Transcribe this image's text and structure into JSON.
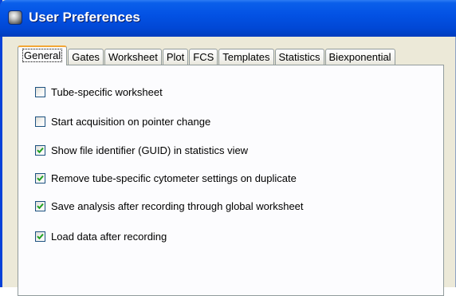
{
  "window": {
    "title": "User Preferences",
    "icon": "app-icon",
    "colors": {
      "titlebar": "#0352e4",
      "frame": "#0842d8",
      "tab_active_accent": "#f3a736",
      "check": "#21a121"
    }
  },
  "tabs": [
    {
      "label": "General",
      "active": true
    },
    {
      "label": "Gates",
      "active": false
    },
    {
      "label": "Worksheet",
      "active": false
    },
    {
      "label": "Plot",
      "active": false
    },
    {
      "label": "FCS",
      "active": false
    },
    {
      "label": "Templates",
      "active": false
    },
    {
      "label": "Statistics",
      "active": false
    },
    {
      "label": "Biexponential",
      "active": false
    }
  ],
  "options": [
    {
      "label": "Tube-specific worksheet",
      "checked": false
    },
    {
      "label": "Start acquisition on pointer change",
      "checked": false
    },
    {
      "label": "Show file identifier (GUID) in statistics view",
      "checked": true
    },
    {
      "label": "Remove tube-specific cytometer settings on duplicate",
      "checked": true
    },
    {
      "label": "Save analysis after recording through global worksheet",
      "checked": true
    },
    {
      "label": "Load data after recording",
      "checked": true
    }
  ]
}
